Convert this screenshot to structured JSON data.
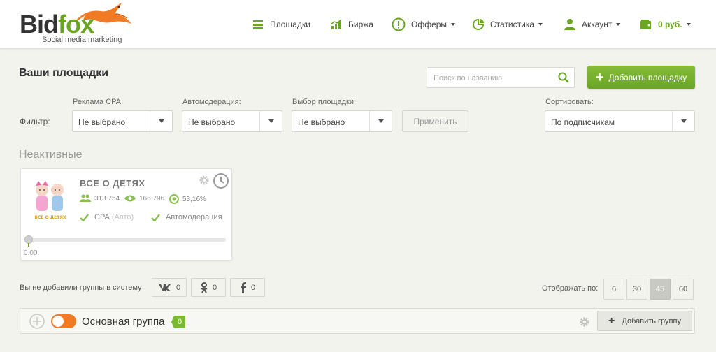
{
  "brand": {
    "name_dark": "Bid",
    "name_green": "fox",
    "tagline": "Social media marketing"
  },
  "nav": {
    "items": [
      {
        "label": "Площадки",
        "icon": "list-icon"
      },
      {
        "label": "Биржа",
        "icon": "chart-icon"
      },
      {
        "label": "Офферы",
        "icon": "alert-icon",
        "dropdown": true
      },
      {
        "label": "Статистика",
        "icon": "stats-icon",
        "dropdown": true
      },
      {
        "label": "Аккаунт",
        "icon": "user-icon",
        "dropdown": true
      },
      {
        "label": "0 руб.",
        "icon": "wallet-icon",
        "dropdown": true
      }
    ]
  },
  "page": {
    "title": "Ваши площадки",
    "search_placeholder": "Поиск по названию",
    "add_button": "Добавить площадку"
  },
  "filters": {
    "label": "Фильтр:",
    "cpa": {
      "label": "Реклама CPA:",
      "value": "Не выбрано"
    },
    "moderation": {
      "label": "Автомодерация:",
      "value": "Не выбрано"
    },
    "platform": {
      "label": "Выбор площадки:",
      "value": "Не выбрано"
    },
    "apply": "Применить",
    "sort": {
      "label": "Сортировать:",
      "value": "По подписчикам"
    }
  },
  "inactive": {
    "title": "Неактивные",
    "card": {
      "name": "ВСЕ О ДЕТЯХ",
      "subscribers": "313 754",
      "views": "166 796",
      "reach": "53,16%",
      "cpa_label": "CPA",
      "cpa_mode": "(Авто)",
      "automod_label": "Автомодерация",
      "progress": 0,
      "progress_value": "0.00",
      "avatar_caption": "ВСЕ О ДЕТЯХ"
    }
  },
  "groups": {
    "empty_text": "Вы не добавили группы в систему",
    "social": [
      {
        "network": "vk",
        "count": "0"
      },
      {
        "network": "ok",
        "count": "0"
      },
      {
        "network": "fb",
        "count": "0"
      }
    ],
    "show_label": "Отображать по:",
    "page_sizes": [
      "6",
      "30",
      "45",
      "60"
    ],
    "active_page_size": "45"
  },
  "group_bar": {
    "name": "Основная группа",
    "count": "0",
    "toggle_on": true,
    "add_button": "Добавить группу"
  },
  "colors": {
    "accent": "#6aa524",
    "toggle": "#f07b24",
    "badge": "#7bb930"
  }
}
